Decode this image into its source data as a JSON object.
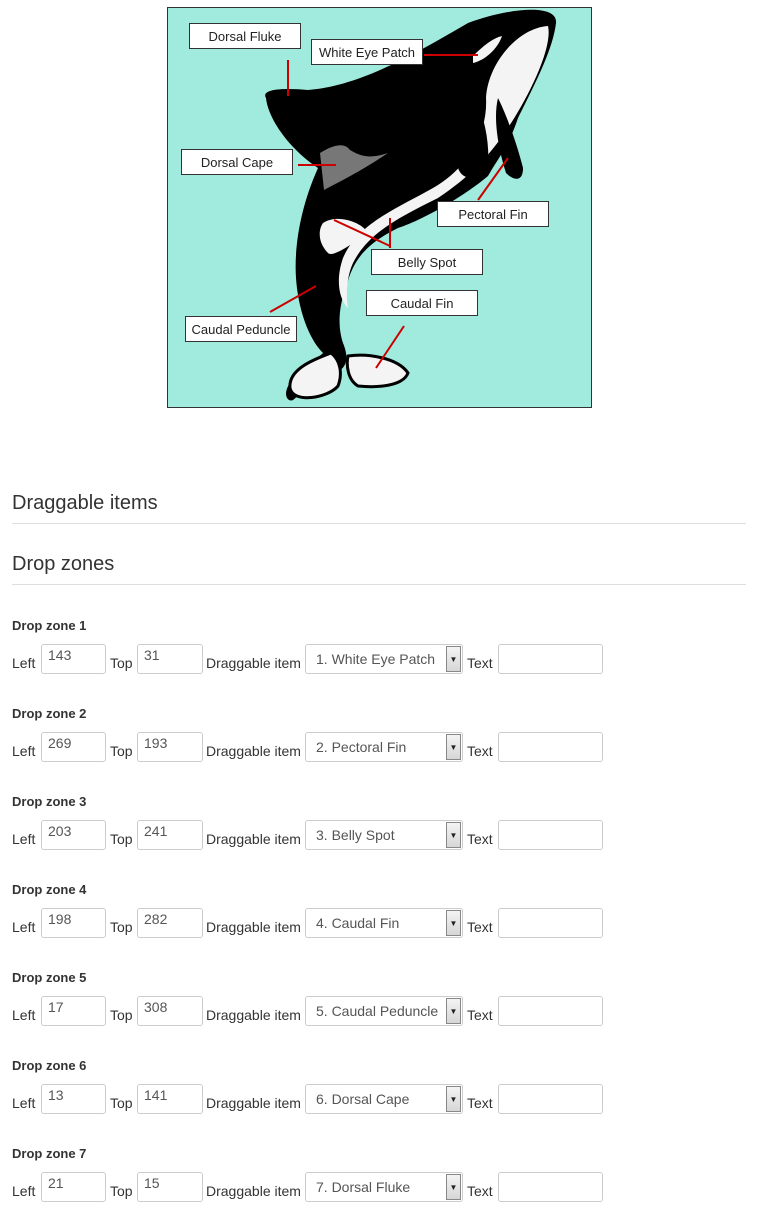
{
  "preview": {
    "background": "#a0ebdd",
    "line_color": "#cc0000",
    "labels": {
      "dorsal_fluke": "Dorsal Fluke",
      "white_eye_patch": "White Eye Patch",
      "dorsal_cape": "Dorsal Cape",
      "pectoral_fin": "Pectoral Fin",
      "belly_spot": "Belly Spot",
      "caudal_fin": "Caudal Fin",
      "caudal_peduncle": "Caudal Peduncle"
    }
  },
  "sections": {
    "draggable_items": "Draggable items",
    "drop_zones": "Drop zones"
  },
  "field_labels": {
    "left": "Left",
    "top": "Top",
    "draggable_item": "Draggable item",
    "text": "Text"
  },
  "drop_zones": [
    {
      "title": "Drop zone 1",
      "left": "143",
      "top": "31",
      "item": "1. White Eye Patch",
      "text": ""
    },
    {
      "title": "Drop zone 2",
      "left": "269",
      "top": "193",
      "item": "2. Pectoral Fin",
      "text": ""
    },
    {
      "title": "Drop zone 3",
      "left": "203",
      "top": "241",
      "item": "3. Belly Spot",
      "text": ""
    },
    {
      "title": "Drop zone 4",
      "left": "198",
      "top": "282",
      "item": "4. Caudal Fin",
      "text": ""
    },
    {
      "title": "Drop zone 5",
      "left": "17",
      "top": "308",
      "item": "5. Caudal Peduncle",
      "text": ""
    },
    {
      "title": "Drop zone 6",
      "left": "13",
      "top": "141",
      "item": "6. Dorsal Cape",
      "text": ""
    },
    {
      "title": "Drop zone 7",
      "left": "21",
      "top": "15",
      "item": "7. Dorsal Fluke",
      "text": ""
    }
  ]
}
